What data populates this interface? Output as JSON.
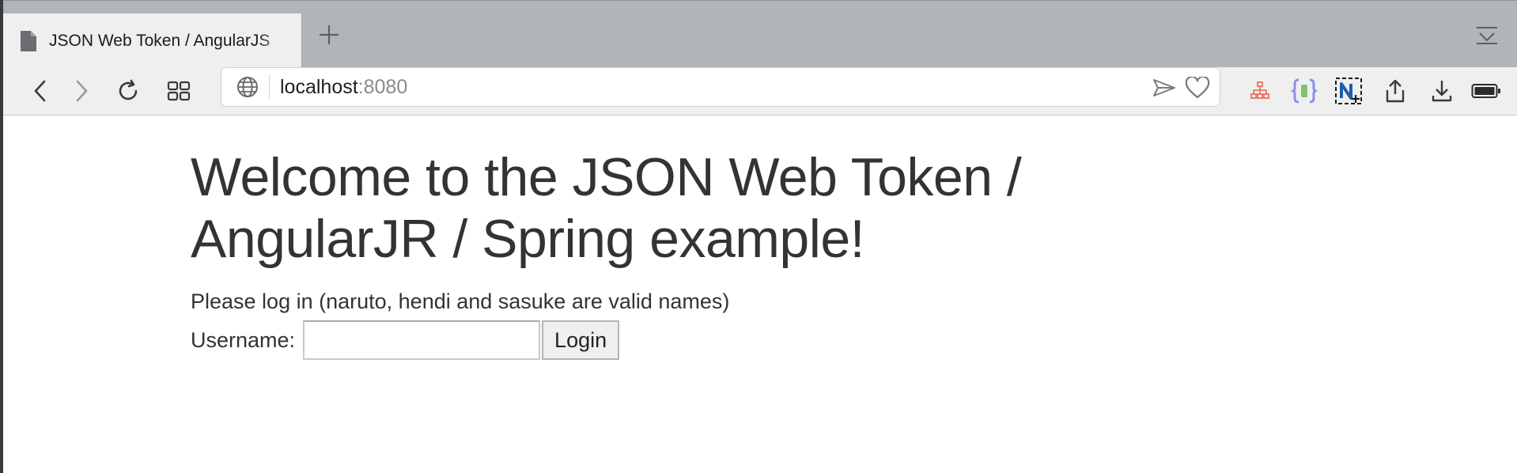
{
  "browser": {
    "tab": {
      "title": "JSON Web Token / AngularJS"
    },
    "address_bar": {
      "host": "localhost",
      "port": ":8080"
    },
    "icons": {
      "back": "chevron-left",
      "forward": "chevron-right",
      "reload": "reload",
      "tab_overview": "grid",
      "globe": "globe",
      "send": "paper-plane",
      "favorite": "heart",
      "extension_1": "sitemap",
      "extension_2": "json-braces",
      "extension_3": "n-capture",
      "share": "share",
      "download": "download",
      "battery": "battery"
    },
    "colors": {
      "tabstrip": "#b1b4b8",
      "toolbar": "#efeff0",
      "extension_1": "#e8725c",
      "extension_2": "#8b8ee8",
      "extension_3": "#1b5fa8"
    }
  },
  "page": {
    "heading": "Welcome to the JSON Web Token / AngularJR / Spring example!",
    "note": "Please log in (naruto, hendi and sasuke are valid names)",
    "login": {
      "label": "Username:",
      "input_value": "",
      "button_label": "Login"
    }
  }
}
